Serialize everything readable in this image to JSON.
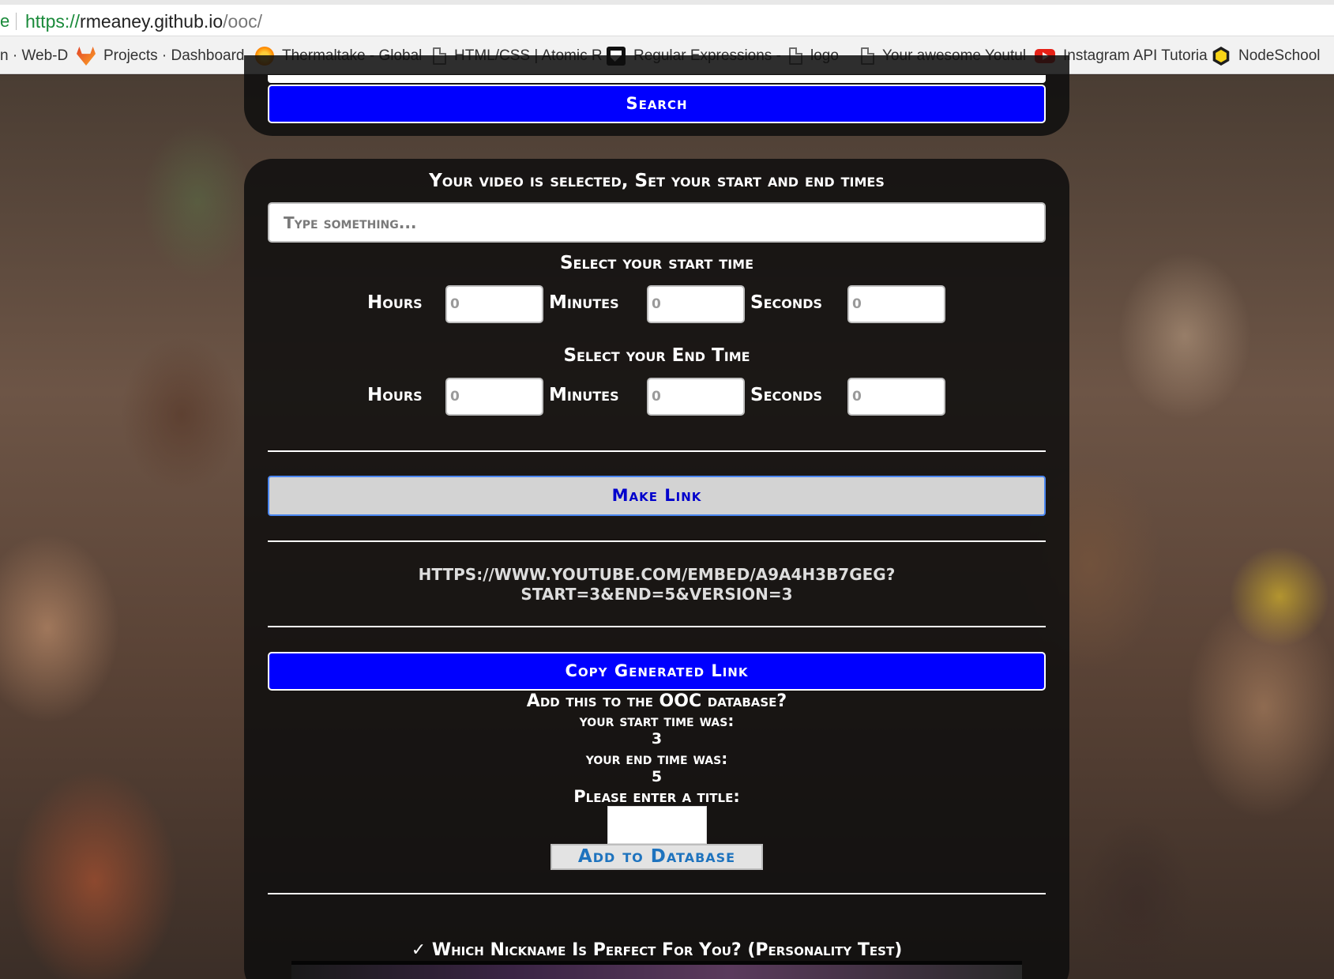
{
  "browser": {
    "edge_char": "e",
    "url_scheme": "https://",
    "url_host": "rmeaney.github.io",
    "url_path": "/ooc/",
    "bookmarks": [
      {
        "label": "n · Web-D",
        "icon": "none"
      },
      {
        "label": "Projects · Dashboard",
        "icon": "gitlab-fox-icon"
      },
      {
        "label": "Thermaltake - Global",
        "icon": "thermaltake-icon"
      },
      {
        "label": "HTML/CSS | Atomic R",
        "icon": "document-icon"
      },
      {
        "label": "Regular Expressions -",
        "icon": "regex-icon"
      },
      {
        "label": "logo",
        "icon": "document-icon"
      },
      {
        "label": "Your awesome Youtul",
        "icon": "document-icon"
      },
      {
        "label": "Instagram API Tutoria",
        "icon": "youtube-icon"
      },
      {
        "label": "NodeSchool",
        "icon": "nodeschool-icon"
      }
    ]
  },
  "search": {
    "button_label": "Search"
  },
  "selector": {
    "heading": "Your video is selected, Set your start and end times",
    "input_placeholder": "Type something...",
    "start_heading": "Select your start time",
    "end_heading": "Select your End Time",
    "hours_label": "Hours",
    "minutes_label": "Minutes",
    "seconds_label": "Seconds",
    "time_placeholder": "0"
  },
  "link": {
    "make_link_label": "Make Link",
    "generated_line1": "https://www.youtube.com/embed/a9A4h3b7geg?",
    "generated_line2": "start=3&end=5&version=3",
    "copy_label": "Copy Generated Link"
  },
  "database": {
    "question": "Add this to the OOC database?",
    "start_label": "your start time was:",
    "start_value": "3",
    "end_label": "your end time was:",
    "end_value": "5",
    "title_prompt": "Please enter a title:",
    "add_button_label": "Add to Database"
  },
  "video": {
    "title": "✓ Which Nickname Is Perfect For You? (Personality Test)"
  },
  "colors": {
    "primary_button": "#0000ff",
    "secondary_button": "#d3d3d3",
    "link_text": "#0000cc",
    "panel": "#0e0e0e"
  }
}
